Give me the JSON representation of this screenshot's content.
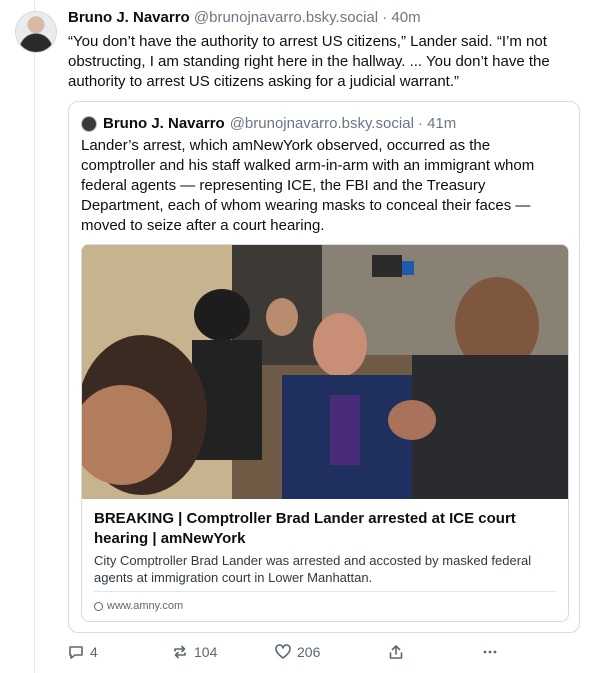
{
  "post": {
    "author": "Bruno J. Navarro",
    "handle": "@brunojnavarro.bsky.social",
    "time": "· 40m",
    "text": "“You don’t have the authority to arrest US citizens,” Lander said. “I’m not obstructing, I am standing right here in the hallway. ... You don’t have the authority to arrest US citizens asking for a judicial warrant.”",
    "avatar_icon": "person-portrait"
  },
  "quote": {
    "author": "Bruno J. Navarro",
    "handle": "@brunojnavarro.bsky.social",
    "time": "· 41m",
    "text": "Lander’s arrest, which amNewYork observed, occurred as the comptroller and his staff walked arm-in-arm with an immigrant whom federal agents — representing ICE, the FBI and the Treasury Department, each of whom wearing masks to conceal their faces — moved to seize after a court hearing."
  },
  "link_card": {
    "title": "BREAKING | Comptroller Brad Lander arrested at ICE court hearing | amNewYork",
    "description": "City Comptroller Brad Lander was arrested and accosted by masked federal agents at immigration court in Lower Manhattan.",
    "domain": "www.amny.com",
    "domain_icon": "globe-icon"
  },
  "actions": {
    "reply_count": "4",
    "repost_count": "104",
    "like_count": "206"
  },
  "colors": {
    "text": "#0b0f14",
    "muted": "#6b7785",
    "border": "#d6dce3"
  }
}
